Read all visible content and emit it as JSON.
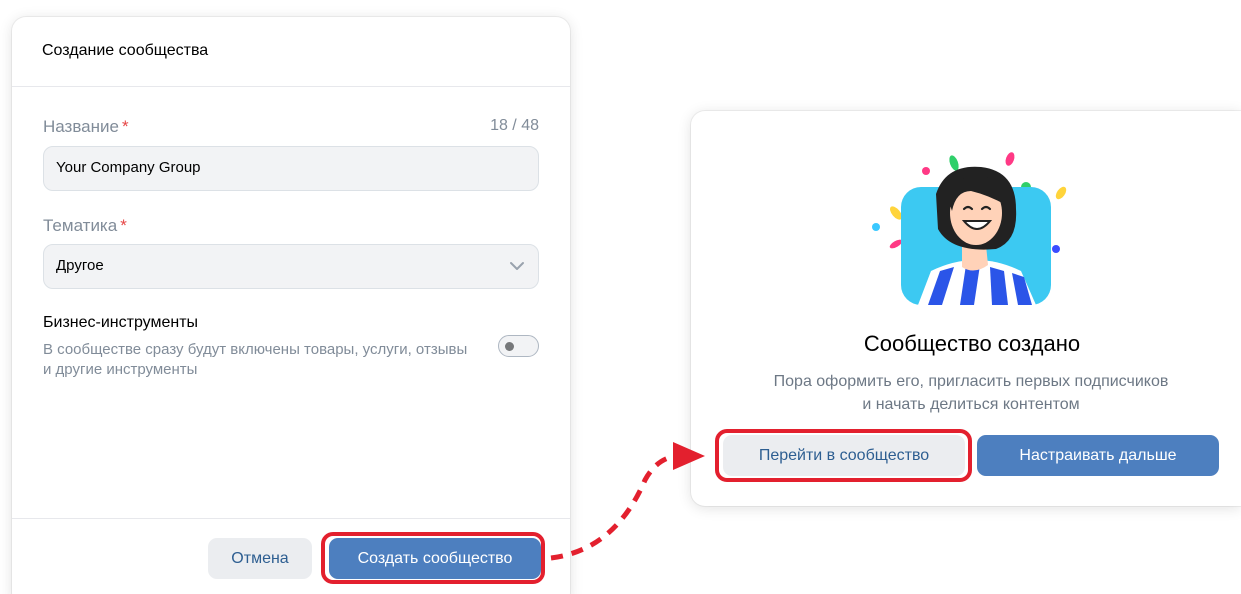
{
  "create_dialog": {
    "title": "Создание сообщества",
    "name_label": "Название",
    "name_counter": "18 / 48",
    "name_value": "Your Company Group",
    "topic_label": "Тематика",
    "topic_value": "Другое",
    "required_mark": "*",
    "business_title": "Бизнес-инструменты",
    "business_desc": "В сообществе сразу будут включены товары, услуги, отзывы и другие инструменты",
    "business_toggle_on": false,
    "cancel_label": "Отмена",
    "create_label": "Создать сообщество"
  },
  "success_dialog": {
    "title": "Сообщество создано",
    "desc_line1": "Пора оформить его, пригласить первых подписчиков",
    "desc_line2": "и начать делиться контентом",
    "go_label": "Перейти в сообщество",
    "next_label": "Настраивать дальше"
  },
  "colors": {
    "primary_button": "#4d7fbf",
    "secondary_button": "#ebedf0",
    "highlight": "#e3202e",
    "required": "#e64646"
  }
}
